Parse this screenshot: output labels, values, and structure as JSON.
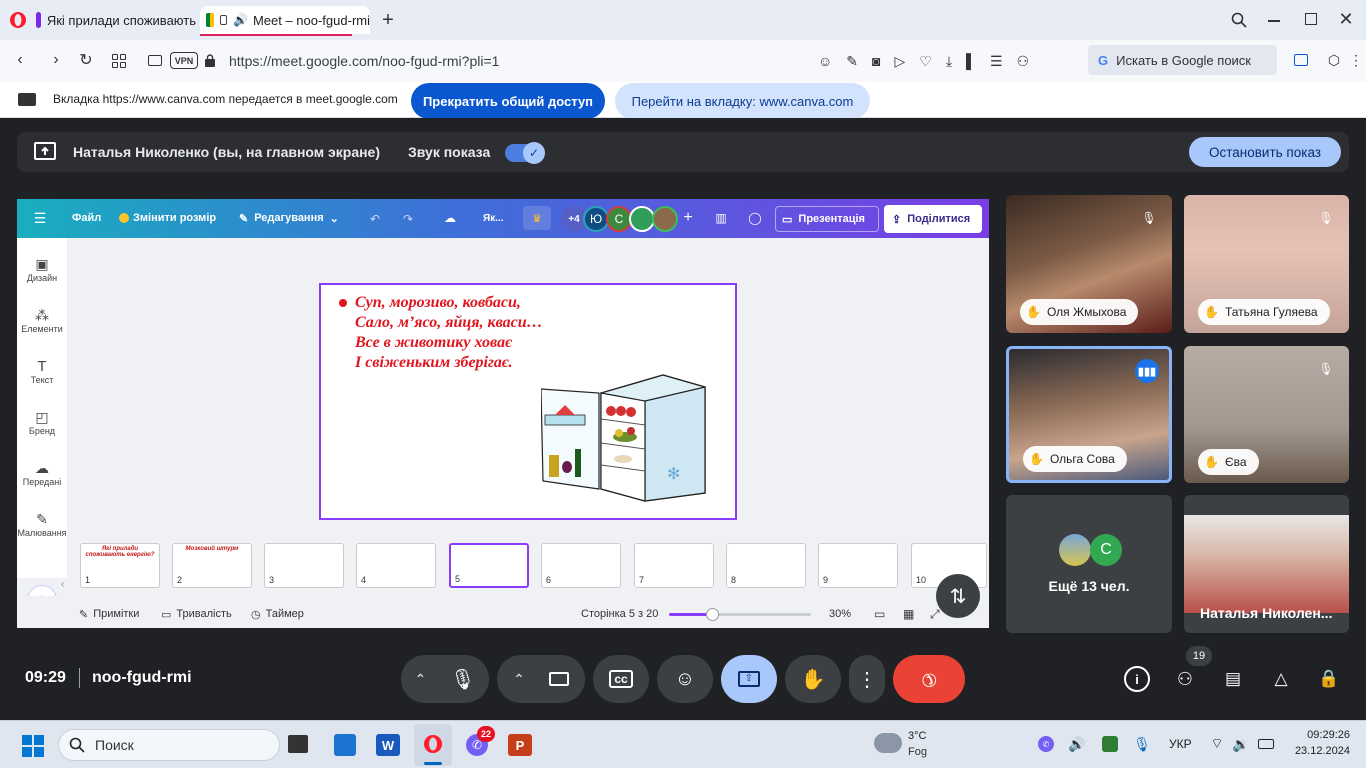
{
  "browser": {
    "tabs": [
      {
        "label": "Які прилади споживають"
      },
      {
        "label": "Meet – noo-fgud-rmi"
      }
    ],
    "url": "https://meet.google.com/noo-fgud-rmi?pli=1",
    "vpn": "VPN",
    "search_label": "Искать в Google поиск"
  },
  "share_banner": {
    "message": "Вкладка https://www.canva.com передается в meet.google.com",
    "stop_button": "Прекратить общий доступ",
    "goto_button": "Перейти на вкладку: www.canva.com"
  },
  "presenter_bar": {
    "presenter": "Наталья Николенко (вы, на главном экране)",
    "sound_label": "Звук показа",
    "sound_on": true,
    "stop_button": "Остановить показ"
  },
  "canva": {
    "menu": {
      "file": "Файл",
      "resize": "Змінити розмір",
      "edit": "Редагування",
      "title_short": "Як...",
      "extra_count": "+4",
      "avatar1": "Ю",
      "avatar2": "С",
      "present": "Презентація",
      "share": "Поділитися"
    },
    "sidebar": [
      {
        "label": "Дизайн",
        "icon": "layout-icon"
      },
      {
        "label": "Елементи",
        "icon": "shapes-icon"
      },
      {
        "label": "Текст",
        "icon": "text-icon"
      },
      {
        "label": "Бренд",
        "icon": "brand-icon"
      },
      {
        "label": "Передані",
        "icon": "cloud-upload-icon"
      },
      {
        "label": "Малювання",
        "icon": "pen-icon"
      }
    ],
    "slide": {
      "lines": [
        "Суп, морозиво, ковбаси,",
        "Сало, м’ясо, яйця, кваси…",
        "Все в животику ховає",
        "І свіженьким зберігає."
      ],
      "text_color": "#e0151f"
    },
    "thumbnails": [
      {
        "num": "1",
        "text": "Які прилади споживають енергію?"
      },
      {
        "num": "2",
        "text": "Мозковий штурм"
      },
      {
        "num": "3",
        "text": ""
      },
      {
        "num": "4",
        "text": ""
      },
      {
        "num": "5",
        "text": ""
      },
      {
        "num": "6",
        "text": ""
      },
      {
        "num": "7",
        "text": ""
      },
      {
        "num": "8",
        "text": ""
      },
      {
        "num": "9",
        "text": ""
      },
      {
        "num": "10",
        "text": ""
      }
    ],
    "bottom": {
      "notes": "Примітки",
      "duration": "Тривалість",
      "timer": "Таймер",
      "page": "Сторінка 5 з 20",
      "zoom_percent": 30,
      "zoom_label": "30%"
    }
  },
  "participants": [
    {
      "name": "Оля Жмыхова",
      "muted": true
    },
    {
      "name": "Татьяна Гуляева",
      "muted": true
    },
    {
      "name": "Ольга Сова",
      "muted": false,
      "speaking": true
    },
    {
      "name": "Єва",
      "muted": true
    }
  ],
  "more_tile": {
    "label": "Ещё 13 чел.",
    "avatar": "С"
  },
  "self_tile": {
    "name": "Наталья Николен..."
  },
  "meeting": {
    "time": "09:29",
    "code": "noo-fgud-rmi",
    "people_count": "19"
  },
  "taskbar": {
    "search": "Поиск",
    "badge": "22",
    "weather_temp": "3°C",
    "weather_desc": "Fog",
    "lang": "УКР",
    "time": "09:29:26",
    "date": "23.12.2024"
  },
  "colors": {
    "meet_bg": "#202124",
    "accent_blue": "#0b57d0",
    "end_call": "#ea4335",
    "canva_purple": "#7d2ae8"
  }
}
